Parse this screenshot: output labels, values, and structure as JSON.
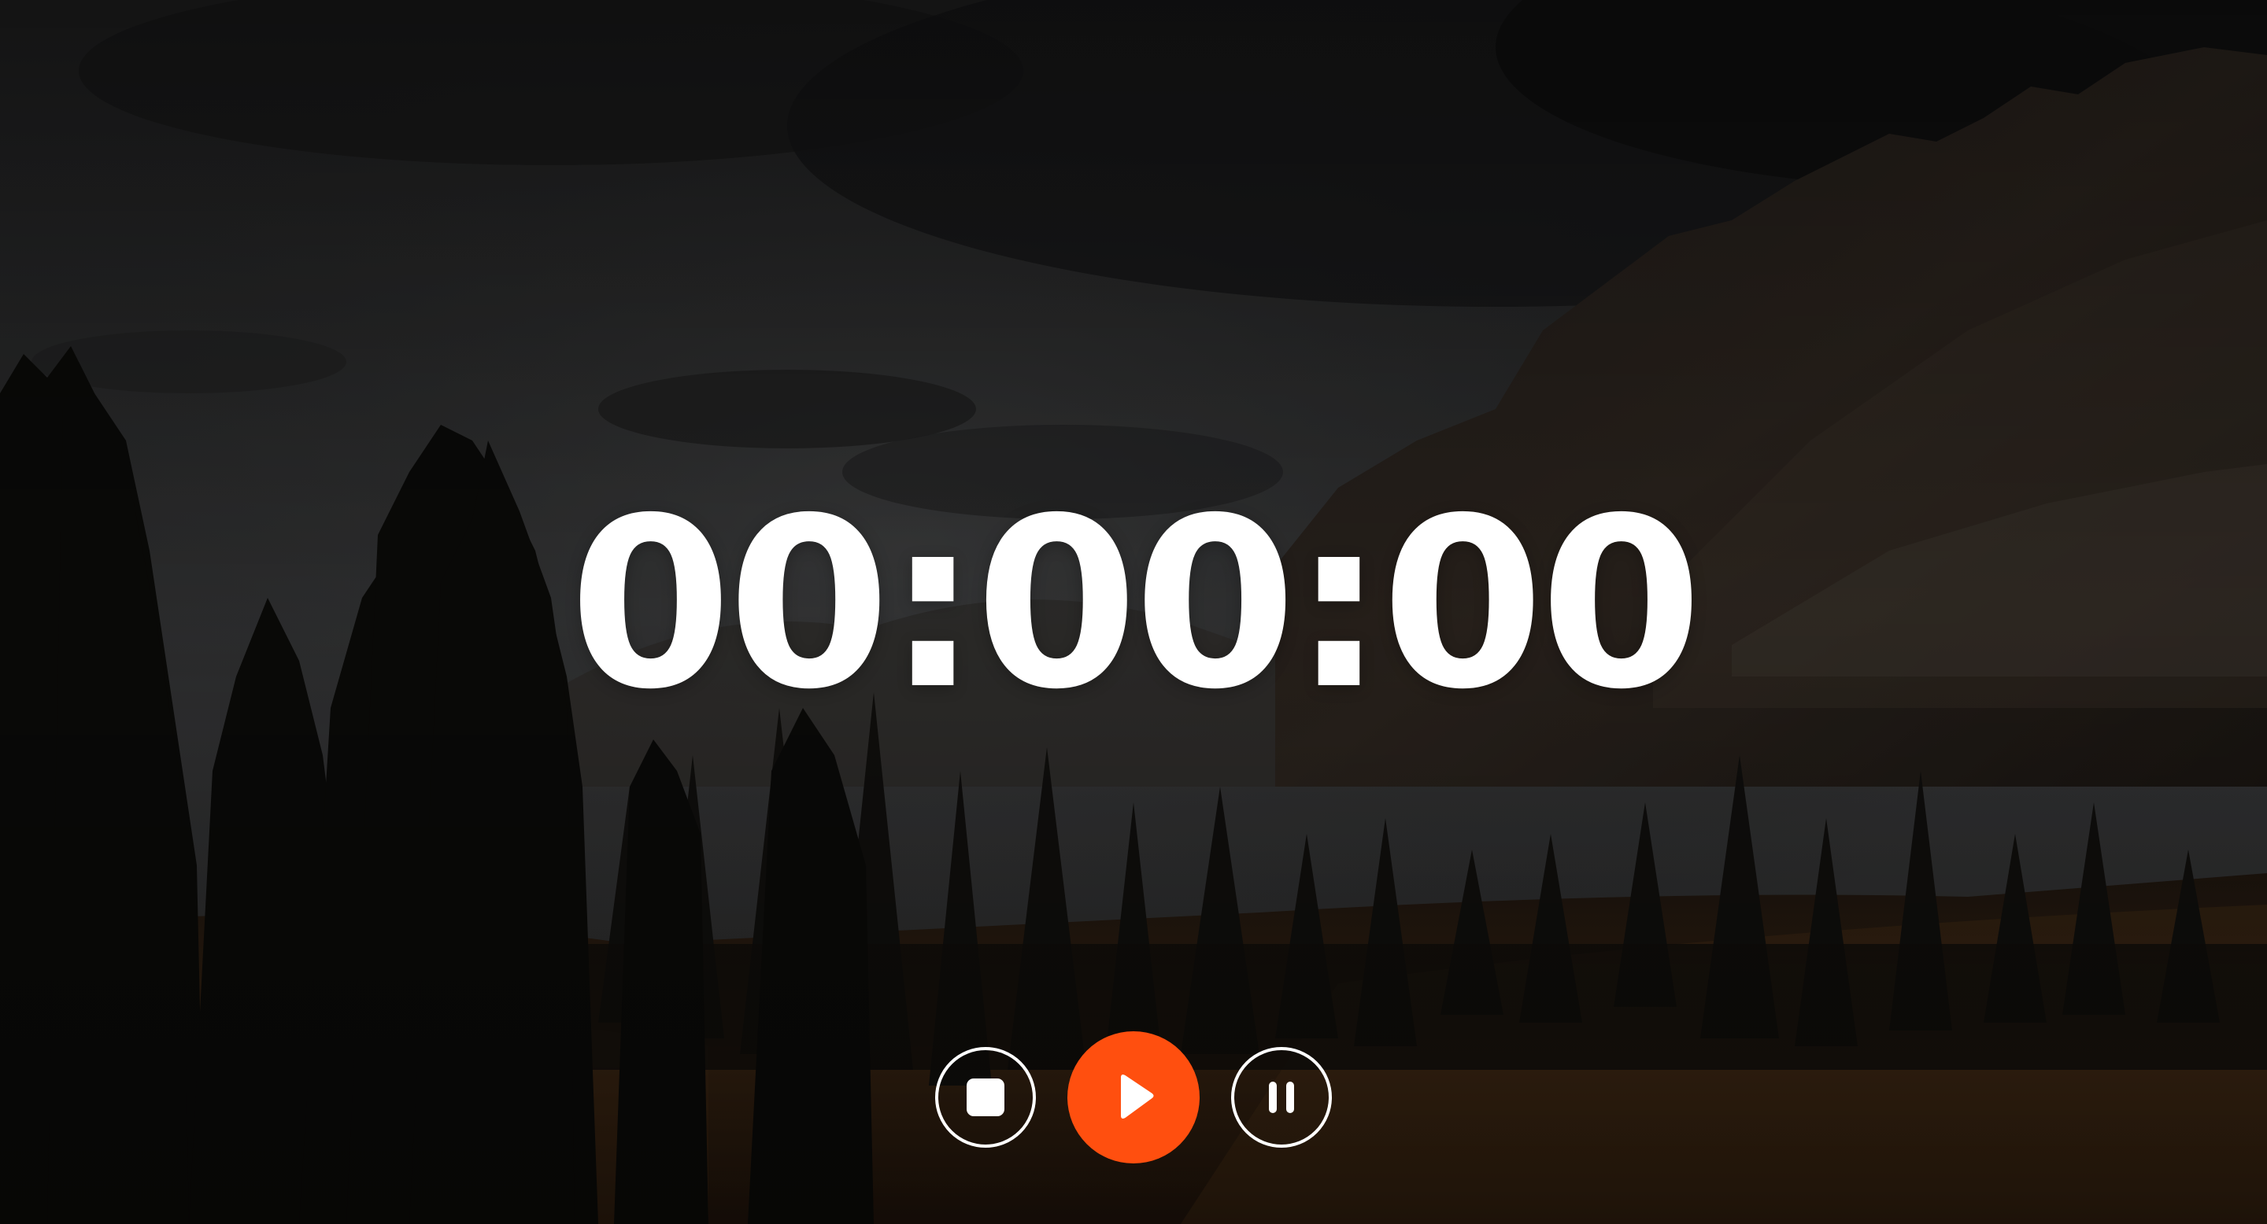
{
  "app": {
    "background": "mountain-forest-photo",
    "accent_color": "#ff4f0f",
    "text_color": "#ffffff"
  },
  "timer": {
    "display": "00:00:00"
  },
  "controls": {
    "stop": {
      "icon": "stop-icon",
      "style": "outlined"
    },
    "play": {
      "icon": "play-icon",
      "style": "filled",
      "color": "#ff4f0f"
    },
    "pause": {
      "icon": "pause-icon",
      "style": "outlined"
    }
  }
}
